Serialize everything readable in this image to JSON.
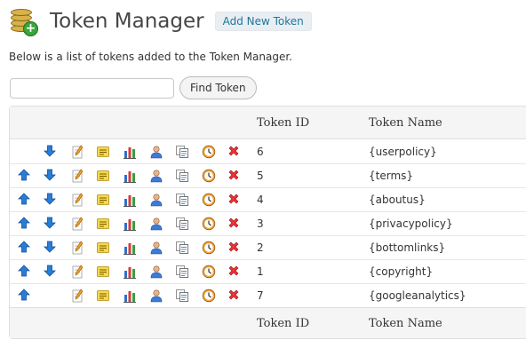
{
  "header": {
    "title": "Token Manager",
    "add_button": "Add New Token"
  },
  "description": "Below is a list of tokens added to the Token Manager.",
  "search": {
    "value": "",
    "placeholder": "",
    "button": "Find Token"
  },
  "table": {
    "columns": {
      "id": "Token ID",
      "name": "Token Name"
    },
    "rows": [
      {
        "id": "6",
        "name": "{userpolicy}",
        "up": false,
        "down": true
      },
      {
        "id": "5",
        "name": "{terms}",
        "up": true,
        "down": true
      },
      {
        "id": "4",
        "name": "{aboutus}",
        "up": true,
        "down": true
      },
      {
        "id": "3",
        "name": "{privacypolicy}",
        "up": true,
        "down": true
      },
      {
        "id": "2",
        "name": "{bottomlinks}",
        "up": true,
        "down": true
      },
      {
        "id": "1",
        "name": "{copyright}",
        "up": true,
        "down": true
      },
      {
        "id": "7",
        "name": "{googleanalytics}",
        "up": true,
        "down": false
      }
    ],
    "row_actions": [
      "move-up-icon",
      "move-down-icon",
      "edit-icon",
      "notes-icon",
      "stats-icon",
      "user-icon",
      "copy-icon",
      "schedule-icon",
      "delete-icon"
    ]
  },
  "colors": {
    "link": "#21759b",
    "delete": "#e0262b",
    "arrow": "#1f6fc2"
  }
}
